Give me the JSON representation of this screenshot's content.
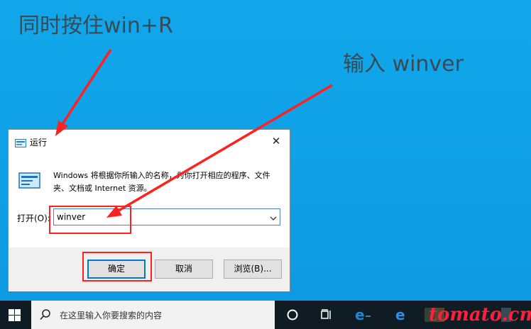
{
  "annotations": {
    "step1": "同时按住win+R",
    "step2": "输入 winver"
  },
  "dialog": {
    "title": "运行",
    "close_glyph": "✕",
    "description": "Windows 将根据你所输入的名称，为你打开相应的程序、文件夹、文档或 Internet 资源。",
    "open_label": "打开(O):",
    "input_value": "winver",
    "buttons": {
      "ok": "确定",
      "cancel": "取消",
      "browse": "浏览(B)..."
    }
  },
  "taskbar": {
    "search_placeholder": "在这里输入你要搜索的内容",
    "icons": [
      "windows-start-icon",
      "search-icon",
      "cortana-icon",
      "task-view-icon",
      "edge-legacy-icon",
      "edge-icon"
    ],
    "watermark": "tomato.cm"
  },
  "colors": {
    "desktop": "#11a7ea",
    "highlight": "#ff2020",
    "accent": "#0078d7",
    "taskbar": "#101c24"
  }
}
